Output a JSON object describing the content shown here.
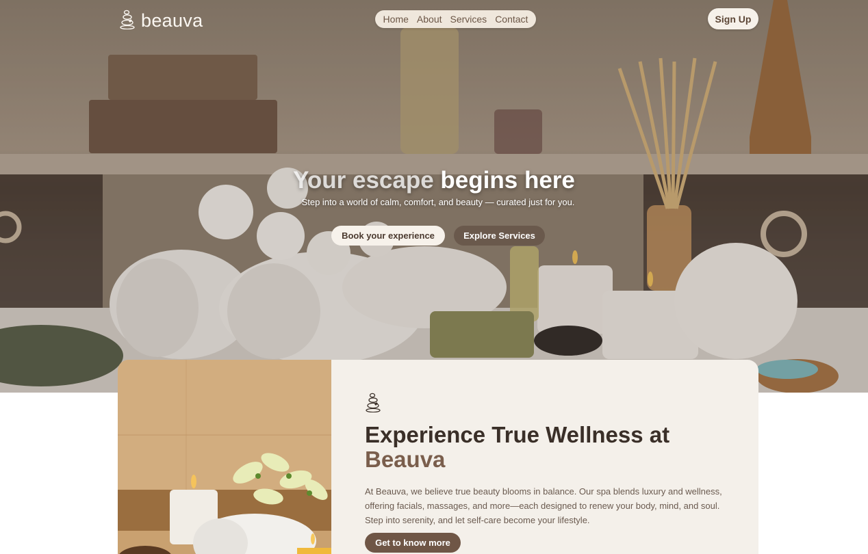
{
  "brand": {
    "name": "beauva",
    "logo_icon": "stacked-stones-icon"
  },
  "nav": {
    "items": [
      "Home",
      "About",
      "Services",
      "Contact"
    ]
  },
  "header": {
    "signup_label": "Sign Up"
  },
  "hero": {
    "title_dim": "Your escape",
    "title_bright": "begins here",
    "subtitle": "Step into a world of calm, comfort, and beauty — curated just for you.",
    "primary_cta": "Book your experience",
    "secondary_cta": "Explore Services"
  },
  "about": {
    "icon": "stacked-stones-icon",
    "title_main": "Experience True Wellness at",
    "title_accent": "Beauva",
    "body": "At Beauva, we believe true beauty blooms in balance. Our spa blends luxury and wellness, offering facials, massages, and more—each designed to renew your body, mind, and soul. Step into serenity, and let self-care become your lifestyle.",
    "cta": "Get to know more"
  },
  "colors": {
    "brand_brown": "#6f5646",
    "accent_brown": "#7a5e4c",
    "cream": "#f4f0ea",
    "dark_text": "#3a2f28"
  }
}
